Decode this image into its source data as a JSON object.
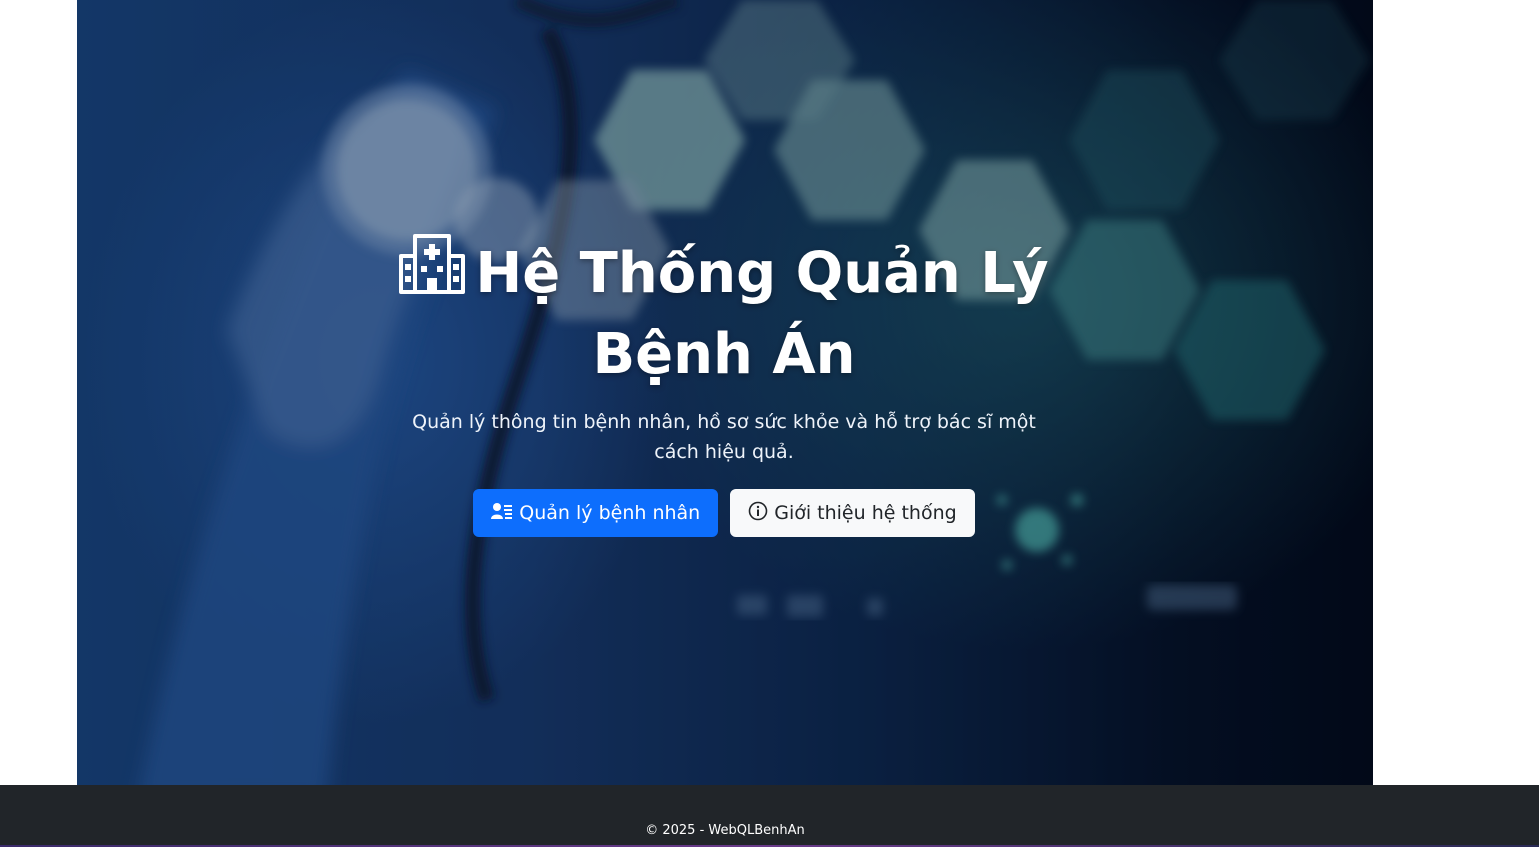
{
  "hero": {
    "title": "Hệ Thống Quản Lý Bệnh Án",
    "title_icon": "hospital-icon",
    "subtitle": "Quản lý thông tin bệnh nhân, hồ sơ sức khỏe và hỗ trợ bác sĩ một cách hiệu quả.",
    "primary_button": {
      "label": "Quản lý bệnh nhân",
      "icon": "person-lines-icon"
    },
    "secondary_button": {
      "label": "Giới thiệu hệ thống",
      "icon": "info-circle-icon"
    }
  },
  "footer": {
    "text": "© 2025 - WebQLBenhAn"
  },
  "colors": {
    "primary": "#0d6efd",
    "light": "#f8f9fa",
    "footer_bg": "#212529",
    "hero_overlay": "#0a1f3d"
  }
}
